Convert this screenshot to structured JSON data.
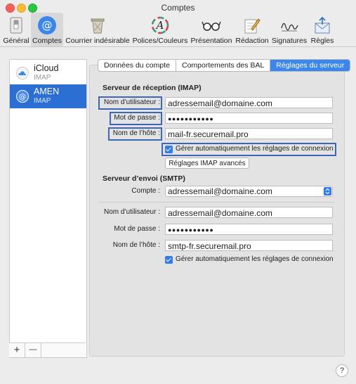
{
  "window": {
    "title": "Comptes"
  },
  "toolbar": {
    "items": [
      {
        "label": "Général",
        "icon": "general-switch-icon"
      },
      {
        "label": "Comptes",
        "icon": "at-sign-icon",
        "selected": true
      },
      {
        "label": "Courrier indésirable",
        "icon": "trash-bin-icon"
      },
      {
        "label": "Polices/Couleurs",
        "icon": "font-colors-icon"
      },
      {
        "label": "Présentation",
        "icon": "glasses-icon"
      },
      {
        "label": "Rédaction",
        "icon": "pencil-paper-icon"
      },
      {
        "label": "Signatures",
        "icon": "signature-icon"
      },
      {
        "label": "Règles",
        "icon": "envelope-rules-icon"
      }
    ]
  },
  "accounts": [
    {
      "name": "iCloud",
      "type": "IMAP",
      "icon": "cloud-icon"
    },
    {
      "name": "AMEN",
      "type": "IMAP",
      "icon": "at-sign-icon",
      "selected": true
    }
  ],
  "sidebar_buttons": {
    "add": "+",
    "remove": "—"
  },
  "tabs": [
    {
      "label": "Données du compte"
    },
    {
      "label": "Comportements des BAL"
    },
    {
      "label": "Réglages du serveur",
      "selected": true
    }
  ],
  "incoming": {
    "section": "Serveur de réception (IMAP)",
    "user_label": "Nom d’utilisateur :",
    "user_value": "adressemail@domaine.com",
    "password_label": "Mot de passe :",
    "password_value": "●●●●●●●●●●●",
    "host_label": "Nom de l’hôte :",
    "host_value": "mail-fr.securemail.pro",
    "auto_label": "Gérer automatiquement les réglages de connexion",
    "auto_checked": true,
    "advanced_button": "Réglages IMAP avancés"
  },
  "outgoing": {
    "section": "Serveur d’envoi (SMTP)",
    "account_label": "Compte :",
    "account_value": "adressemail@domaine.com",
    "user_label": "Nom d’utilisateur :",
    "user_value": "adressemail@domaine.com",
    "password_label": "Mot de passe :",
    "password_value": "●●●●●●●●●●●",
    "host_label": "Nom de l’hôte :",
    "host_value": "smtp-fr.securemail.pro",
    "auto_label": "Gérer automatiquement les réglages de connexion",
    "auto_checked": true
  },
  "help": "?",
  "colors": {
    "selection": "#2b6fd5",
    "tab_selected": "#3c87ee",
    "highlight": "#3d65b8"
  }
}
